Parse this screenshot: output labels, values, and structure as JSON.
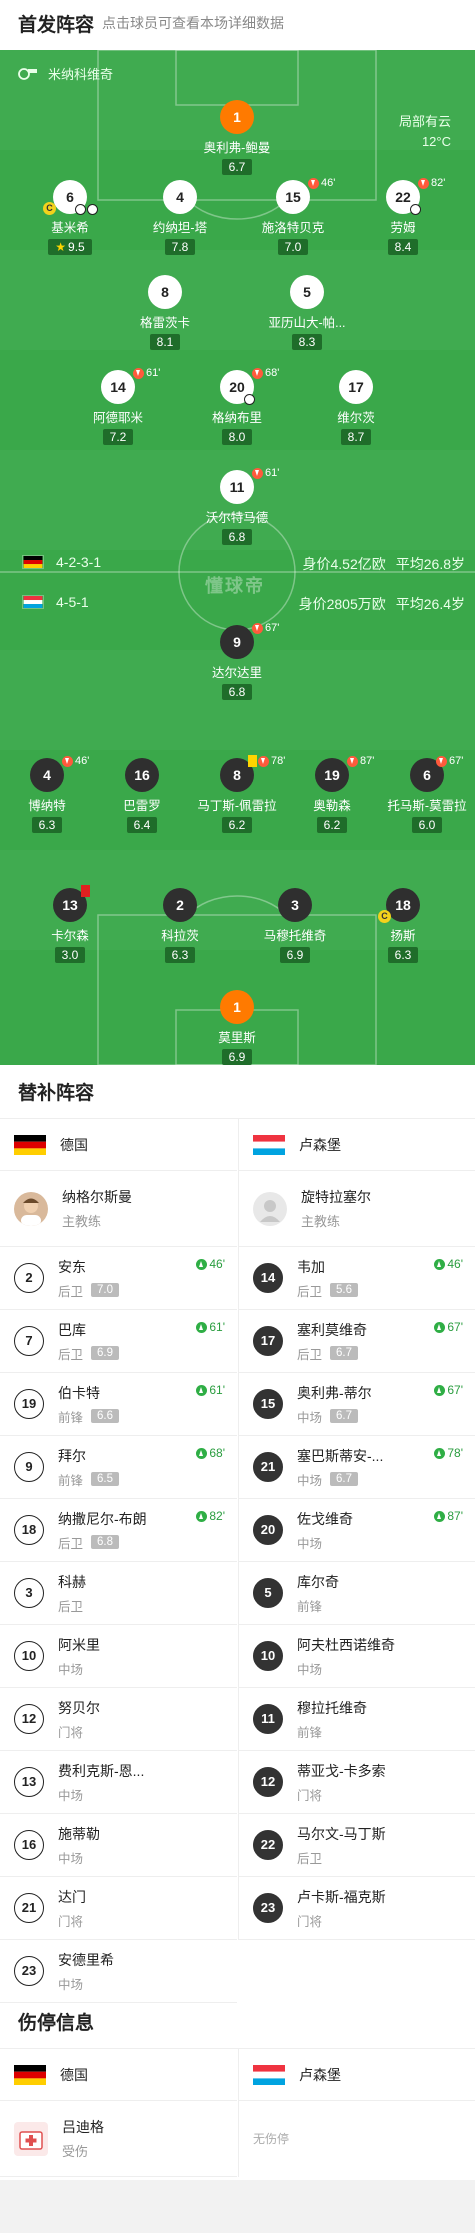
{
  "header": {
    "title": "首发阵容",
    "subtitle": "点击球员可查看本场详细数据"
  },
  "pitch": {
    "stadium": "米纳科维奇",
    "weather": "局部有云",
    "temperature": "12°C",
    "watermark": "懂球帝",
    "home": {
      "formation": "4-2-3-1",
      "value": "身价4.52亿欧",
      "age": "平均26.8岁",
      "flag": "germany"
    },
    "away": {
      "formation": "4-5-1",
      "value": "身价2805万欧",
      "age": "平均26.4岁",
      "flag": "luxembourg"
    },
    "home_players": [
      {
        "num": "1",
        "name": "奥利弗-鲍曼",
        "rating": "6.7"
      },
      {
        "num": "6",
        "name": "基米希",
        "rating": "9.5"
      },
      {
        "num": "4",
        "name": "约纳坦-塔",
        "rating": "7.8"
      },
      {
        "num": "15",
        "name": "施洛特贝克",
        "rating": "7.0",
        "sub": "46'"
      },
      {
        "num": "22",
        "name": "劳姆",
        "rating": "8.4",
        "sub": "82'"
      },
      {
        "num": "8",
        "name": "格雷茨卡",
        "rating": "8.1"
      },
      {
        "num": "5",
        "name": "亚历山大-帕...",
        "rating": "8.3"
      },
      {
        "num": "14",
        "name": "阿德耶米",
        "rating": "7.2",
        "sub": "61'"
      },
      {
        "num": "20",
        "name": "格纳布里",
        "rating": "8.0",
        "sub": "68'"
      },
      {
        "num": "17",
        "name": "维尔茨",
        "rating": "8.7"
      },
      {
        "num": "11",
        "name": "沃尔特马德",
        "rating": "6.8",
        "sub": "61'"
      }
    ],
    "away_players": [
      {
        "num": "9",
        "name": "达尔达里",
        "rating": "6.8",
        "sub": "67'"
      },
      {
        "num": "4",
        "name": "博纳特",
        "rating": "6.3",
        "sub": "46'"
      },
      {
        "num": "16",
        "name": "巴雷罗",
        "rating": "6.4"
      },
      {
        "num": "8",
        "name": "马丁斯-佩雷拉",
        "rating": "6.2",
        "sub": "78'"
      },
      {
        "num": "19",
        "name": "奥勒森",
        "rating": "6.2",
        "sub": "87'"
      },
      {
        "num": "6",
        "name": "托马斯-莫雷拉",
        "rating": "6.0",
        "sub": "67'"
      },
      {
        "num": "13",
        "name": "卡尔森",
        "rating": "3.0"
      },
      {
        "num": "2",
        "name": "科拉茨",
        "rating": "6.3"
      },
      {
        "num": "3",
        "name": "马穆托维奇",
        "rating": "6.9"
      },
      {
        "num": "18",
        "name": "扬斯",
        "rating": "6.3"
      },
      {
        "num": "1",
        "name": "莫里斯",
        "rating": "6.9"
      }
    ]
  },
  "subs": {
    "title": "替补阵容",
    "home_team": "德国",
    "away_team": "卢森堡",
    "home_coach": {
      "name": "纳格尔斯曼",
      "role": "主教练"
    },
    "away_coach": {
      "name": "旋特拉塞尔",
      "role": "主教练"
    },
    "home": [
      {
        "num": "2",
        "name": "安东",
        "pos": "后卫",
        "rating": "7.0",
        "in": "46'"
      },
      {
        "num": "7",
        "name": "巴库",
        "pos": "后卫",
        "rating": "6.9",
        "in": "61'"
      },
      {
        "num": "19",
        "name": "伯卡特",
        "pos": "前锋",
        "rating": "6.6",
        "in": "61'"
      },
      {
        "num": "9",
        "name": "拜尔",
        "pos": "前锋",
        "rating": "6.5",
        "in": "68'"
      },
      {
        "num": "18",
        "name": "纳撒尼尔-布朗",
        "pos": "后卫",
        "rating": "6.8",
        "in": "82'"
      },
      {
        "num": "3",
        "name": "科赫",
        "pos": "后卫"
      },
      {
        "num": "10",
        "name": "阿米里",
        "pos": "中场"
      },
      {
        "num": "12",
        "name": "努贝尔",
        "pos": "门将"
      },
      {
        "num": "13",
        "name": "费利克斯-恩...",
        "pos": "中场"
      },
      {
        "num": "16",
        "name": "施蒂勒",
        "pos": "中场"
      },
      {
        "num": "21",
        "name": "达门",
        "pos": "门将"
      },
      {
        "num": "23",
        "name": "安德里希",
        "pos": "中场"
      }
    ],
    "away": [
      {
        "num": "14",
        "name": "韦加",
        "pos": "后卫",
        "rating": "5.6",
        "in": "46'"
      },
      {
        "num": "17",
        "name": "塞利莫维奇",
        "pos": "后卫",
        "rating": "6.7",
        "in": "67'"
      },
      {
        "num": "15",
        "name": "奥利弗-蒂尔",
        "pos": "中场",
        "rating": "6.7",
        "in": "67'"
      },
      {
        "num": "21",
        "name": "塞巴斯蒂安-...",
        "pos": "中场",
        "rating": "6.7",
        "in": "78'"
      },
      {
        "num": "20",
        "name": "佐戈维奇",
        "pos": "中场",
        "in": "87'"
      },
      {
        "num": "5",
        "name": "库尔奇",
        "pos": "前锋"
      },
      {
        "num": "10",
        "name": "阿夫杜西诺维奇",
        "pos": "中场"
      },
      {
        "num": "11",
        "name": "穆拉托维奇",
        "pos": "前锋"
      },
      {
        "num": "12",
        "name": "蒂亚戈-卡多索",
        "pos": "门将"
      },
      {
        "num": "22",
        "name": "马尔文-马丁斯",
        "pos": "后卫"
      },
      {
        "num": "23",
        "name": "卢卡斯-福克斯",
        "pos": "门将"
      }
    ]
  },
  "injuries": {
    "title": "伤停信息",
    "home_team": "德国",
    "away_team": "卢森堡",
    "home_player": {
      "name": "吕迪格",
      "status": "受伤"
    },
    "away_none": "无伤停"
  },
  "colors": {
    "pitch": "#3aa84a",
    "gk": "#ff7a00",
    "rating_bg": "#1f6d2a",
    "sub_out": "#ff5a3c",
    "sub_in": "#2fae45"
  }
}
